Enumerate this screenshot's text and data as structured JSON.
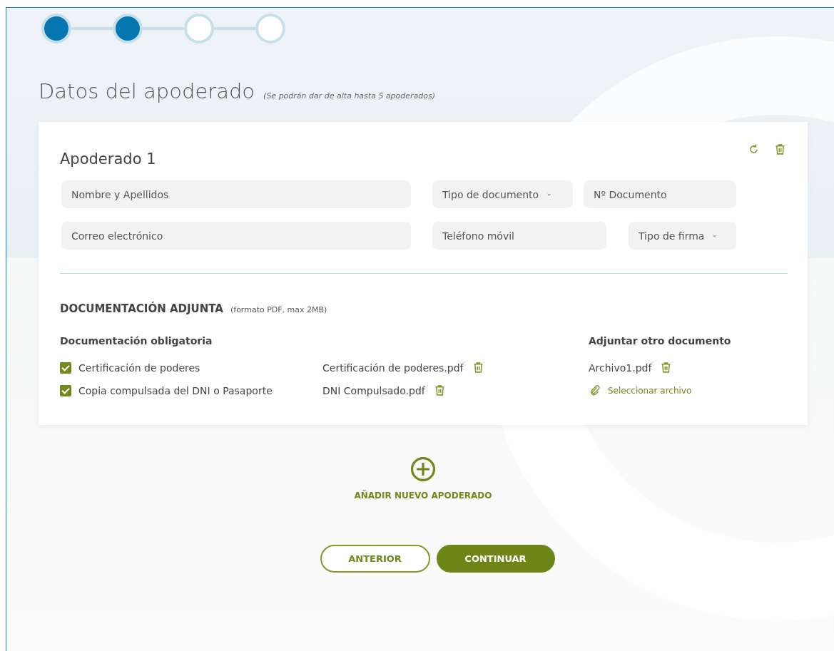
{
  "stepper": [
    {
      "completed": true
    },
    {
      "completed": true
    },
    {
      "completed": false
    },
    {
      "completed": false
    }
  ],
  "title": "Datos del apoderado",
  "subtitle": "(Se podrán dar de alta hasta 5 apoderados)",
  "card": {
    "heading": "Apoderado 1",
    "fields": [
      [
        {
          "kind": "text",
          "placeholder": "Nombre y Apellidos"
        },
        {
          "kind": "select",
          "placeholder": "Tipo de documento"
        },
        {
          "kind": "text",
          "placeholder": "Nº Documento"
        }
      ],
      [
        {
          "kind": "text",
          "placeholder": "Correo electrónico"
        },
        {
          "kind": "text",
          "placeholder": "Teléfono móvil"
        },
        {
          "kind": "select",
          "placeholder": "Tipo de firma"
        }
      ]
    ],
    "attachments": {
      "title": "DOCUMENTACIÓN ADJUNTA",
      "note": "(formato PDF, max 2MB)",
      "required_title": "Documentación obligatoria",
      "required": [
        {
          "label": "Certificación de poderes",
          "checked": true,
          "file": "Certificación de poderes.pdf"
        },
        {
          "label": "Copia compulsada del DNI o Pasaporte",
          "checked": true,
          "file": "DNI Compulsado.pdf"
        }
      ],
      "other_title": "Adjuntar otro documento",
      "other_files": [
        "Archivo1.pdf"
      ],
      "select_link": "Seleccionar archivo"
    }
  },
  "add_label": "AÑADIR NUEVO APODERADO",
  "buttons": [
    {
      "kind": "outline",
      "label": "ANTERIOR"
    },
    {
      "kind": "primary",
      "label": "CONTINUAR"
    }
  ]
}
